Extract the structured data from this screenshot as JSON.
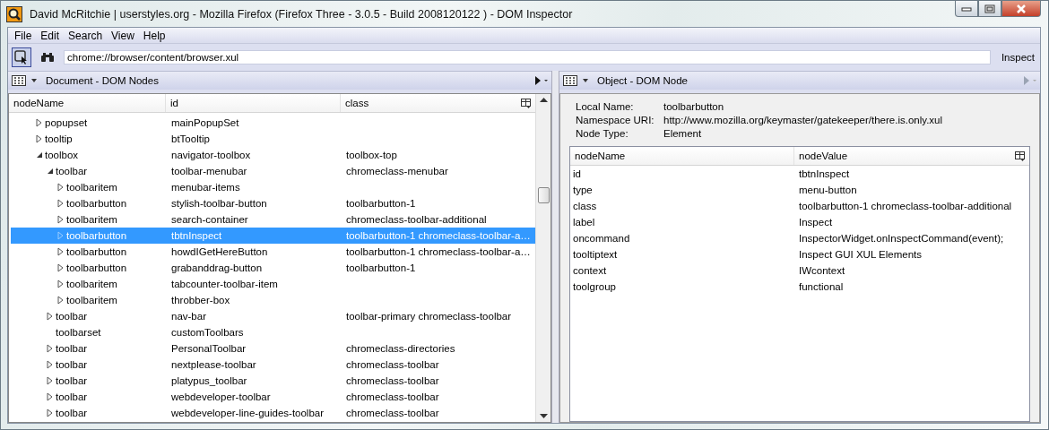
{
  "window": {
    "title": "David McRitchie | userstyles.org - Mozilla Firefox (Firefox Three - 3.0.5 - Build 2008120122 ) - DOM Inspector"
  },
  "menu": [
    {
      "label": "File"
    },
    {
      "label": "Edit"
    },
    {
      "label": "Search"
    },
    {
      "label": "View"
    },
    {
      "label": "Help"
    }
  ],
  "toolbar": {
    "address": "chrome://browser/content/browser.xul",
    "inspect_button": "Inspect"
  },
  "left_panel": {
    "title": "Document - DOM Nodes",
    "columns": [
      "nodeName",
      "id",
      "class"
    ],
    "tree": [
      {
        "nodeName": "popupset",
        "id": "mainPopupSet",
        "expanded": false,
        "selected": false
      },
      {
        "nodeName": "tooltip",
        "id": "btTooltip",
        "expanded": false,
        "selected": false
      },
      {
        "nodeName": "toolbox",
        "id": "navigator-toolbox",
        "class": "toolbox-top",
        "expanded": true,
        "selected": false,
        "children": [
          {
            "nodeName": "toolbar",
            "id": "toolbar-menubar",
            "class": "chromeclass-menubar",
            "expanded": true,
            "selected": false,
            "children": [
              {
                "nodeName": "toolbaritem",
                "id": "menubar-items",
                "expanded": false,
                "selected": false
              },
              {
                "nodeName": "toolbarbutton",
                "id": "stylish-toolbar-button",
                "class": "toolbarbutton-1",
                "expanded": false,
                "selected": false
              },
              {
                "nodeName": "toolbaritem",
                "id": "search-container",
                "class": "chromeclass-toolbar-additional",
                "expanded": false,
                "selected": false
              },
              {
                "nodeName": "toolbarbutton",
                "id": "tbtnInspect",
                "class": "toolbarbutton-1 chromeclass-toolbar-a…",
                "expanded": false,
                "selected": true
              },
              {
                "nodeName": "toolbarbutton",
                "id": "howdIGetHereButton",
                "class": "toolbarbutton-1 chromeclass-toolbar-a…",
                "expanded": false,
                "selected": false
              },
              {
                "nodeName": "toolbarbutton",
                "id": "grabanddrag-button",
                "class": "toolbarbutton-1",
                "expanded": false,
                "selected": false
              },
              {
                "nodeName": "toolbaritem",
                "id": "tabcounter-toolbar-item",
                "expanded": false,
                "selected": false
              },
              {
                "nodeName": "toolbaritem",
                "id": "throbber-box",
                "expanded": false,
                "selected": false
              }
            ]
          },
          {
            "nodeName": "toolbar",
            "id": "nav-bar",
            "class": "toolbar-primary chromeclass-toolbar",
            "expanded": false,
            "selected": false
          },
          {
            "nodeName": "toolbarset",
            "id": "customToolbars",
            "selected": false
          },
          {
            "nodeName": "toolbar",
            "id": "PersonalToolbar",
            "class": "chromeclass-directories",
            "expanded": false,
            "selected": false
          },
          {
            "nodeName": "toolbar",
            "id": "nextplease-toolbar",
            "class": "chromeclass-toolbar",
            "expanded": false,
            "selected": false
          },
          {
            "nodeName": "toolbar",
            "id": "platypus_toolbar",
            "class": "chromeclass-toolbar",
            "expanded": false,
            "selected": false
          },
          {
            "nodeName": "toolbar",
            "id": "webdeveloper-toolbar",
            "class": "chromeclass-toolbar",
            "expanded": false,
            "selected": false
          },
          {
            "nodeName": "toolbar",
            "id": "webdeveloper-line-guides-toolbar",
            "class": "chromeclass-toolbar",
            "expanded": false,
            "selected": false
          }
        ]
      }
    ]
  },
  "right_panel": {
    "title": "Object - DOM Node",
    "info": [
      {
        "label": "Local Name:",
        "value": "toolbarbutton"
      },
      {
        "label": "Namespace URI:",
        "value": "http://www.mozilla.org/keymaster/gatekeeper/there.is.only.xul"
      },
      {
        "label": "Node Type:",
        "value": "Element"
      }
    ],
    "columns": [
      "nodeName",
      "nodeValue"
    ],
    "attributes": [
      {
        "name": "id",
        "value": "tbtnInspect"
      },
      {
        "name": "type",
        "value": "menu-button"
      },
      {
        "name": "class",
        "value": "toolbarbutton-1 chromeclass-toolbar-additional"
      },
      {
        "name": "label",
        "value": "Inspect"
      },
      {
        "name": "oncommand",
        "value": "InspectorWidget.onInspectCommand(event);"
      },
      {
        "name": "tooltiptext",
        "value": "Inspect GUI XUL Elements"
      },
      {
        "name": "context",
        "value": "IWcontext"
      },
      {
        "name": "toolgroup",
        "value": "functional"
      }
    ]
  }
}
